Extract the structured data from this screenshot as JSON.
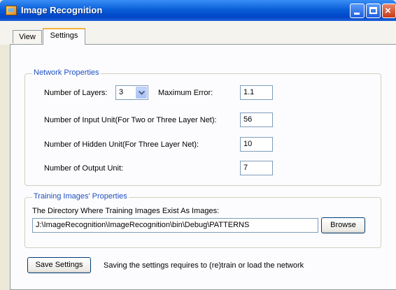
{
  "window": {
    "title": "Image Recognition"
  },
  "tabs": [
    {
      "label": "View"
    },
    {
      "label": "Settings"
    }
  ],
  "network": {
    "legend": "Network Properties",
    "layers_label": "Number of Layers:",
    "layers_value": "3",
    "max_error_label": "Maximum Error:",
    "max_error_value": "1.1",
    "input_units_label": "Number of Input Unit(For Two or Three Layer Net):",
    "input_units_value": "56",
    "hidden_units_label": "Number of Hidden Unit(For Three Layer Net):",
    "hidden_units_value": "10",
    "output_units_label": "Number of Output Unit:",
    "output_units_value": "7"
  },
  "training": {
    "legend": "Training Images' Properties",
    "directory_label": "The Directory Where Training Images Exist As Images:",
    "directory_value": "J:\\ImageRecognition\\ImageRecognition\\bin\\Debug\\PATTERNS",
    "browse_label": "Browse"
  },
  "footer": {
    "save_label": "Save Settings",
    "note": "Saving the settings requires to (re)train or load the network"
  },
  "icons": [
    "app-icon",
    "minimize-icon",
    "maximize-icon",
    "close-icon",
    "chevron-down-icon"
  ]
}
